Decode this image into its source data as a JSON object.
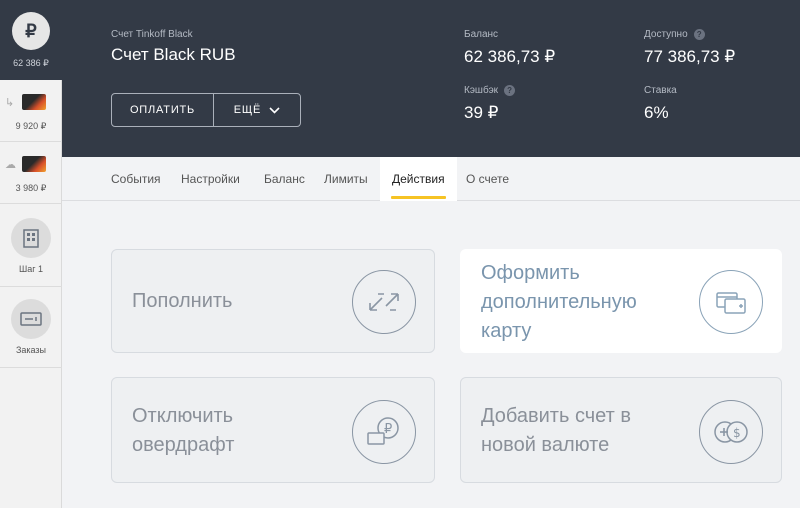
{
  "sidebar": {
    "account_amount": "62 386 ₽",
    "account_icon": "ruble-sign-icon",
    "card1_amount": "9 920 ₽",
    "card2_amount": "3 980 ₽",
    "nav": [
      {
        "label": "Шаг 1",
        "icon": "building-icon"
      },
      {
        "label": "Заказы",
        "icon": "ticket-icon"
      }
    ]
  },
  "header": {
    "account_subtitle": "Счет Tinkoff Black",
    "account_title": "Счет Black RUB",
    "pay_button": "ОПЛАТИТЬ",
    "more_button": "ЕЩЁ",
    "balance_label": "Баланс",
    "balance_value": "62 386,73 ₽",
    "available_label": "Доступно",
    "available_value": "77 386,73 ₽",
    "cashback_label": "Кэшбэк",
    "cashback_value": "39 ₽",
    "rate_label": "Ставка",
    "rate_value": "6%"
  },
  "tabs": {
    "items": [
      "События",
      "Настройки",
      "Баланс",
      "Лимиты",
      "Действия",
      "О счете"
    ],
    "active": "Действия"
  },
  "cards": [
    {
      "text": "Пополнить",
      "icon": "transfer-arrows-icon"
    },
    {
      "text": "Оформить дополнительную карту",
      "icon": "add-card-icon"
    },
    {
      "text": "Отключить овердрафт",
      "icon": "ruble-coin-card-icon"
    },
    {
      "text": "Добавить счет в новой валюте",
      "icon": "add-currency-icon"
    }
  ],
  "colors": {
    "header_bg": "#333a46",
    "accent_tab": "#f6c324"
  }
}
